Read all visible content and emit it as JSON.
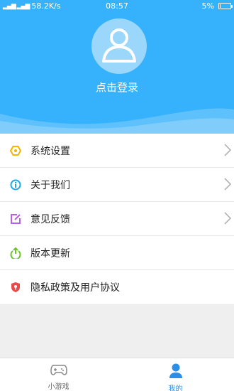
{
  "status_bar": {
    "network_speed": "58.2K/s",
    "time": "08:57",
    "battery_percent": "5%",
    "battery_level": 0.05
  },
  "profile": {
    "login_label": "点击登录"
  },
  "menu": {
    "items": [
      {
        "label": "系统设置",
        "icon": "gear-icon",
        "color": "#f5b400",
        "has_arrow": true
      },
      {
        "label": "关于我们",
        "icon": "info-icon",
        "color": "#1aa9e8",
        "has_arrow": true
      },
      {
        "label": "意见反馈",
        "icon": "edit-icon",
        "color": "#b460e8",
        "has_arrow": true
      },
      {
        "label": "版本更新",
        "icon": "update-icon",
        "color": "#6cc62a",
        "has_arrow": false
      },
      {
        "label": "隐私政策及用户协议",
        "icon": "shield-icon",
        "color": "#e84a4a",
        "has_arrow": false
      }
    ]
  },
  "tabbar": {
    "tabs": [
      {
        "label": "小游戏",
        "icon": "gamepad-icon",
        "active": false
      },
      {
        "label": "我的",
        "icon": "user-icon",
        "active": true
      }
    ]
  },
  "colors": {
    "header": "#35b2fb",
    "active_tab": "#2b8fe8"
  }
}
